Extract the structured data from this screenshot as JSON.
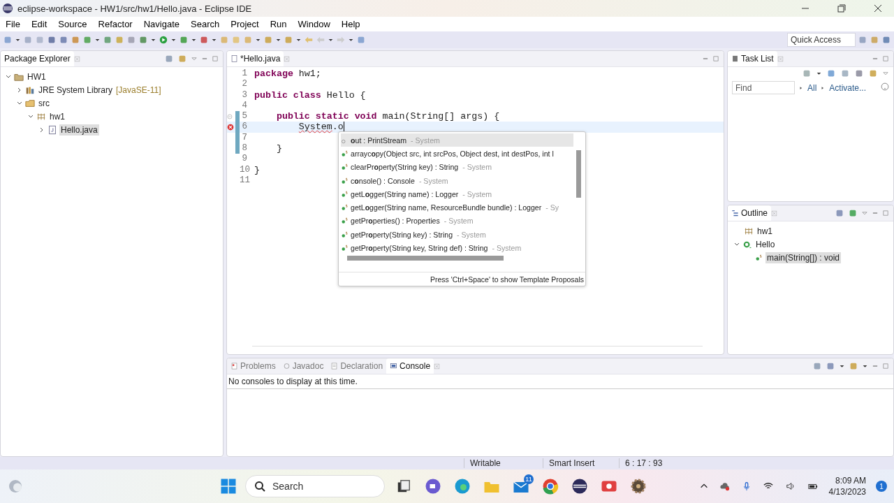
{
  "window": {
    "title": "eclipse-workspace - HW1/src/hw1/Hello.java - Eclipse IDE"
  },
  "menu": [
    "File",
    "Edit",
    "Source",
    "Refactor",
    "Navigate",
    "Search",
    "Project",
    "Run",
    "Window",
    "Help"
  ],
  "toolbar": {
    "quick_access": {
      "placeholder": "Quick Access"
    }
  },
  "package_explorer": {
    "title": "Package Explorer",
    "tree": [
      {
        "label": "HW1",
        "kind": "project",
        "expanded": true,
        "selected": false,
        "children": [
          {
            "label": "JRE System Library",
            "decoration": "[JavaSE-11]",
            "kind": "library",
            "expanded": false,
            "selected": false
          },
          {
            "label": "src",
            "kind": "source",
            "expanded": true,
            "selected": false,
            "children": [
              {
                "label": "hw1",
                "kind": "package",
                "expanded": true,
                "selected": false,
                "children": [
                  {
                    "label": "Hello.java",
                    "kind": "file",
                    "expanded": false,
                    "selected": true
                  }
                ]
              }
            ]
          }
        ]
      }
    ]
  },
  "editor": {
    "tab": {
      "label": "*Hello.java"
    },
    "lines": [
      {
        "number": "1",
        "kind": "plain",
        "current": false,
        "changed": false,
        "tokens": [
          {
            "text": "package",
            "kind": "keyword"
          },
          {
            "text": " hw1;",
            "kind": "plain"
          }
        ]
      },
      {
        "number": "2",
        "kind": "plain",
        "current": false,
        "changed": false
      },
      {
        "number": "3",
        "kind": "plain",
        "current": false,
        "changed": false,
        "tokens": [
          {
            "text": "public class",
            "kind": "keyword"
          },
          {
            "text": " Hello {",
            "kind": "plain"
          }
        ]
      },
      {
        "number": "4",
        "kind": "plain",
        "current": false,
        "changed": false
      },
      {
        "number": "5",
        "kind": "fold",
        "current": false,
        "changed": true,
        "tokens": [
          {
            "text": "    public static void",
            "kind": "keyword"
          },
          {
            "text": " main(String[] args) {",
            "kind": "plain"
          }
        ]
      },
      {
        "number": "6",
        "kind": "error",
        "current": true,
        "changed": true,
        "tokens": [
          {
            "text": "        System",
            "kind": "error"
          },
          {
            "text": ".o",
            "kind": "plain"
          }
        ]
      },
      {
        "number": "7",
        "kind": "plain",
        "current": false,
        "changed": true
      },
      {
        "number": "8",
        "kind": "plain",
        "current": false,
        "changed": true,
        "tokens": [
          {
            "text": "    }",
            "kind": "plain"
          }
        ]
      },
      {
        "number": "9",
        "kind": "plain",
        "current": false,
        "changed": false
      },
      {
        "number": "10",
        "kind": "plain",
        "current": false,
        "changed": false,
        "tokens": [
          {
            "text": "}",
            "kind": "plain"
          }
        ]
      },
      {
        "number": "11",
        "kind": "plain",
        "current": false,
        "changed": false
      }
    ]
  },
  "completion": {
    "items": [
      {
        "kind": "field",
        "label": "**o**ut : PrintStream",
        "qualifier": "- System",
        "selected": true
      },
      {
        "kind": "method",
        "label": "arrayc**o**py(Object src, int srcPos, Object dest, int destPos, int l",
        "selected": false
      },
      {
        "kind": "method",
        "label": "clearPr**o**perty(String key) : String",
        "qualifier": "- System",
        "selected": false
      },
      {
        "kind": "method",
        "label": "c**o**nsole() : Console",
        "qualifier": "- System",
        "selected": false
      },
      {
        "kind": "method",
        "label": "getL**o**gger(String name) : Logger",
        "qualifier": "- System",
        "selected": false
      },
      {
        "kind": "method",
        "label": "getL**o**gger(String name, ResourceBundle bundle) : Logger",
        "qualifier": "- Sy",
        "selected": false
      },
      {
        "kind": "method",
        "label": "getPr**o**perties() : Properties",
        "qualifier": "- System",
        "selected": false
      },
      {
        "kind": "method",
        "label": "getPr**o**perty(String key) : String",
        "qualifier": "- System",
        "selected": false
      },
      {
        "kind": "method",
        "label": "getPr**o**perty(String key, String def) : String",
        "qualifier": "- System",
        "selected": false
      }
    ],
    "footer": "Press 'Ctrl+Space' to show Template Proposals"
  },
  "task_list": {
    "title": "Task List",
    "find": {
      "placeholder": "Find"
    },
    "links": [
      "All",
      "Activate..."
    ]
  },
  "outline": {
    "title": "Outline",
    "tree": [
      {
        "label": "hw1",
        "kind": "package",
        "selected": false
      },
      {
        "label": "Hello",
        "kind": "class",
        "expanded": true,
        "selected": false,
        "children": [
          {
            "label": "main(String[]) : void",
            "kind": "method",
            "selected": true
          }
        ]
      }
    ]
  },
  "bottom": {
    "tabs": [
      {
        "label": "Problems",
        "kind": "problems",
        "selected": false
      },
      {
        "label": "Javadoc",
        "kind": "javadoc",
        "selected": false
      },
      {
        "label": "Declaration",
        "kind": "declaration",
        "selected": false
      },
      {
        "label": "Console",
        "kind": "console",
        "selected": true
      }
    ],
    "message": "No consoles to display at this time."
  },
  "status_bar": [
    "Writable",
    "Smart Insert",
    "6 : 17 : 93"
  ],
  "taskbar": {
    "search": {
      "placeholder": "Search"
    },
    "mail_badge": "11",
    "time": "8:09 AM",
    "date": "4/13/2023",
    "notification_badge": "1"
  }
}
